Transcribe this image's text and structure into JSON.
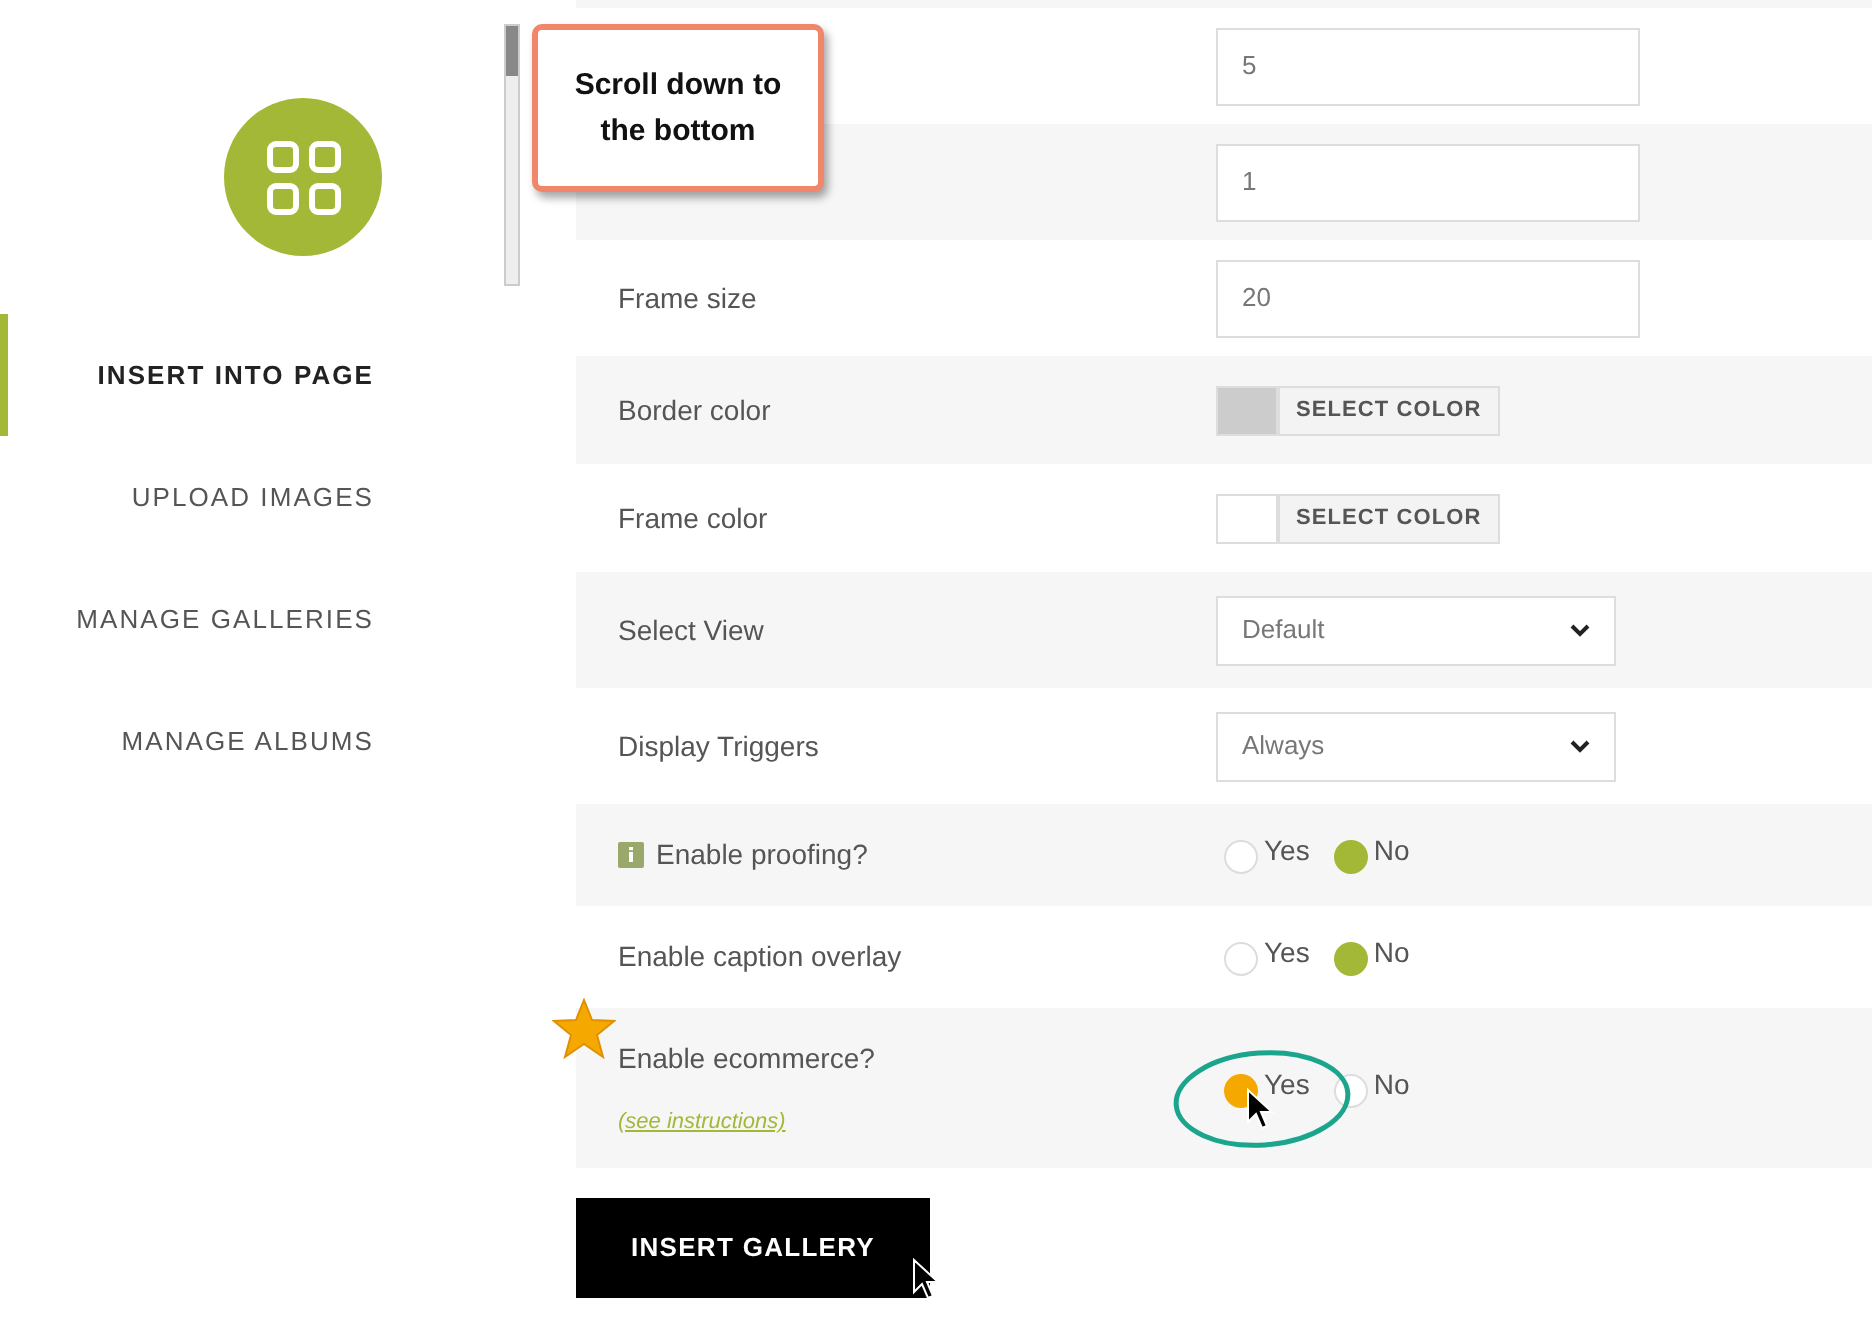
{
  "sidebar": {
    "items": [
      {
        "label": "INSERT INTO PAGE",
        "selected": true
      },
      {
        "label": "UPLOAD IMAGES",
        "selected": false
      },
      {
        "label": "MANAGE GALLERIES",
        "selected": false
      },
      {
        "label": "MANAGE ALBUMS",
        "selected": false
      }
    ]
  },
  "form": {
    "rows": [
      {
        "kind": "text",
        "value": "5"
      },
      {
        "kind": "text",
        "value": "1"
      },
      {
        "kind": "text",
        "label": "Frame size",
        "value": "20"
      },
      {
        "kind": "color",
        "label": "Border color",
        "color": "#cccccc",
        "button": "SELECT COLOR"
      },
      {
        "kind": "color",
        "label": "Frame color",
        "color": "#ffffff",
        "button": "SELECT COLOR"
      },
      {
        "kind": "select",
        "label": "Select View",
        "value": "Default"
      },
      {
        "kind": "select",
        "label": "Display Triggers",
        "value": "Always"
      },
      {
        "kind": "radio",
        "label": "Enable proofing?",
        "info": true,
        "options": [
          {
            "label": "Yes",
            "selected": false
          },
          {
            "label": "No",
            "selected": true
          }
        ]
      },
      {
        "kind": "radio",
        "label": "Enable caption overlay",
        "options": [
          {
            "label": "Yes",
            "selected": false
          },
          {
            "label": "No",
            "selected": true
          }
        ]
      },
      {
        "kind": "radio",
        "label": "Enable ecommerce?",
        "link": "(see instructions)",
        "highlight": true,
        "options": [
          {
            "label": "Yes",
            "selected": true
          },
          {
            "label": "No",
            "selected": false
          }
        ]
      }
    ]
  },
  "submit": "INSERT GALLERY",
  "callout": "Scroll down to the bottom"
}
